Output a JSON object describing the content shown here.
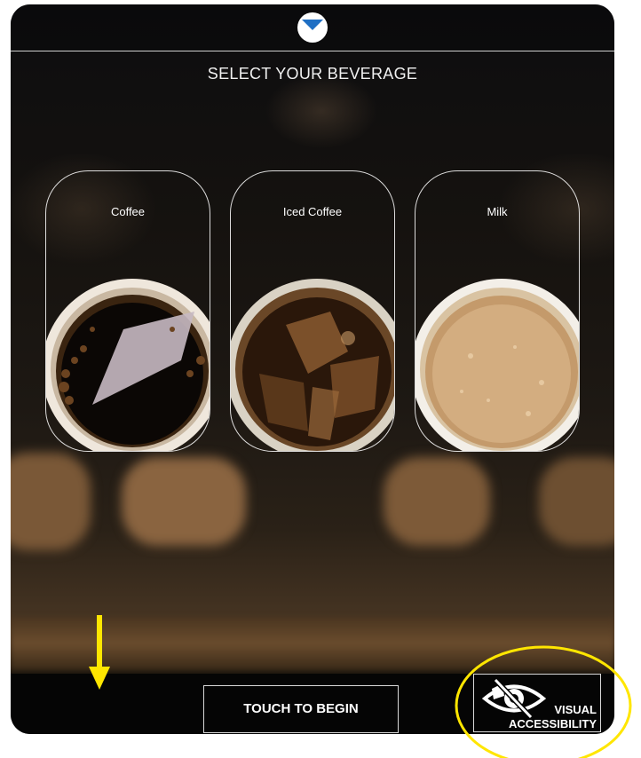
{
  "header": {
    "title": "SELECT YOUR BEVERAGE",
    "logo_icon": "brand-logo-icon"
  },
  "beverages": [
    {
      "label": "Coffee",
      "image": "black-coffee-cup"
    },
    {
      "label": "Iced Coffee",
      "image": "iced-coffee-cup"
    },
    {
      "label": "Milk",
      "image": "frothed-milk-cup"
    }
  ],
  "footer": {
    "begin_label": "TOUCH TO BEGIN",
    "accessibility_line1": "VISUAL",
    "accessibility_line2": "ACCESSIBILITY",
    "accessibility_icon": "eye-slash-icon"
  },
  "colors": {
    "accent_blue": "#1f6fc4",
    "annotation_yellow": "#ffe600",
    "panel_black": "#050505"
  }
}
